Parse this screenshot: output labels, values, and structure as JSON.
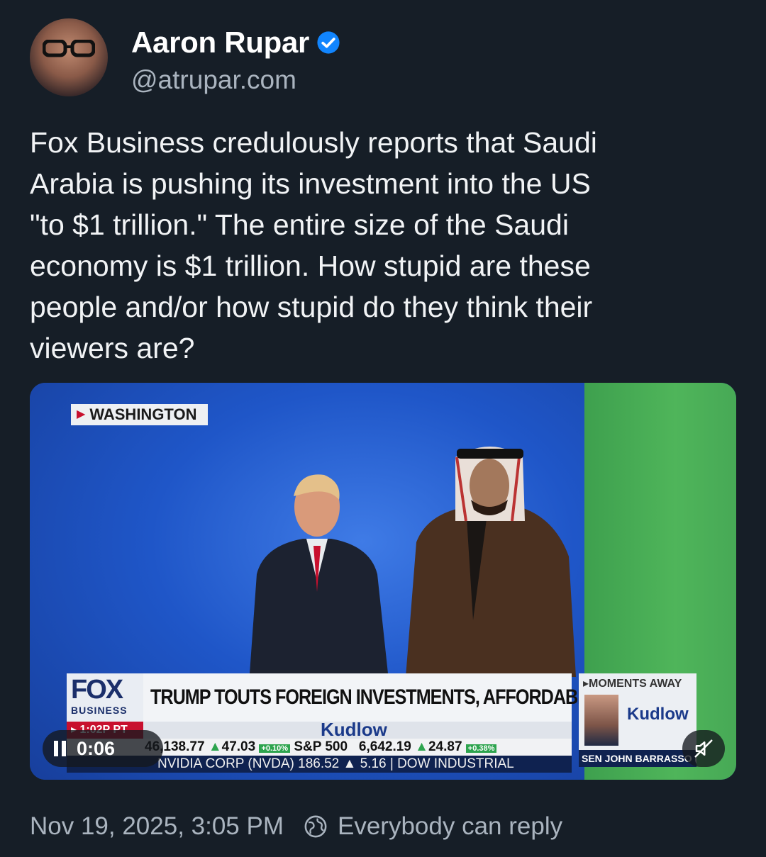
{
  "author": {
    "name": "Aaron Rupar",
    "handle": "@atrupar.com",
    "verified": true,
    "verified_color": "#1185fe"
  },
  "post": {
    "text": "Fox Business credulously reports that Saudi\nArabia is pushing its investment into the US\n\"to $1 trillion.\" The entire size of the Saudi\neconomy is $1 trillion. How stupid are these\npeople and/or how stupid do they think their\nviewers are?"
  },
  "video": {
    "location_tag": "WASHINGTON",
    "logo_fox": "FOX",
    "logo_business": "BUSINESS",
    "headline": "TRUMP TOUTS FOREIGN INVESTMENTS, AFFORDABILITY",
    "time_tag": "▸ 1:02P PT",
    "show_name": "Kudlow",
    "ticker_line1": {
      "dow_value": "46,138.77",
      "dow_change": "47.03",
      "dow_pct": "+0.10%",
      "sp_label": "S&P 500",
      "sp_value": "6,642.19",
      "sp_change": "24.87",
      "sp_pct": "+0.38%"
    },
    "ticker_line2": "NVIDIA CORP (NVDA)  186.52  ▲ 5.16  |  DOW INDUSTRIAL",
    "moments_label": "▸MOMENTS AWAY",
    "moments_show": "Kudlow",
    "guest_name": "SEN JOHN BARRASSO (R-WY)",
    "elapsed": "0:06"
  },
  "footer": {
    "timestamp": "Nov 19, 2025, 3:05 PM",
    "reply_setting": "Everybody can reply"
  }
}
